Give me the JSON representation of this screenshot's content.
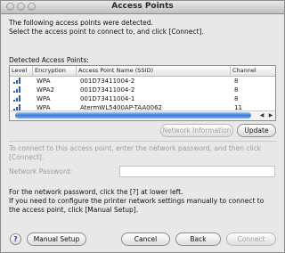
{
  "window": {
    "title": "Access Points"
  },
  "intro": {
    "line1": "The following access points were detected.",
    "line2": "Select the access point to connect to, and click [Connect]."
  },
  "list": {
    "label": "Detected Access Points:",
    "columns": [
      "Level",
      "Encryption",
      "Access Point Name (SSID)",
      "Channel"
    ],
    "rows": [
      {
        "encryption": "WPA",
        "ssid": "001D73411004-2",
        "channel": "8"
      },
      {
        "encryption": "WPA2",
        "ssid": "001D73411004-2",
        "channel": "8"
      },
      {
        "encryption": "WPA",
        "ssid": "001D73411004-1",
        "channel": "8"
      },
      {
        "encryption": "WPA",
        "ssid": "AtermWL5400AP-TAA0062",
        "channel": "11"
      }
    ]
  },
  "buttons": {
    "network_info": "Network Information",
    "update": "Update",
    "manual_setup": "Manual Setup",
    "cancel": "Cancel",
    "back": "Back",
    "connect": "Connect",
    "help": "?"
  },
  "instructions": {
    "line1": "To connect to this access point, enter the network password, and then click",
    "line2": "[Connect]."
  },
  "password": {
    "label": "Network Password:",
    "value": ""
  },
  "note": {
    "line1": "For the network password, click the [?] at lower left.",
    "line2": "If you need to configure the printer network settings manually to connect to",
    "line3": "the access point, click [Manual Setup]."
  },
  "colors": {
    "accent": "#3a7ad6",
    "signal": "#2b5fb0"
  }
}
